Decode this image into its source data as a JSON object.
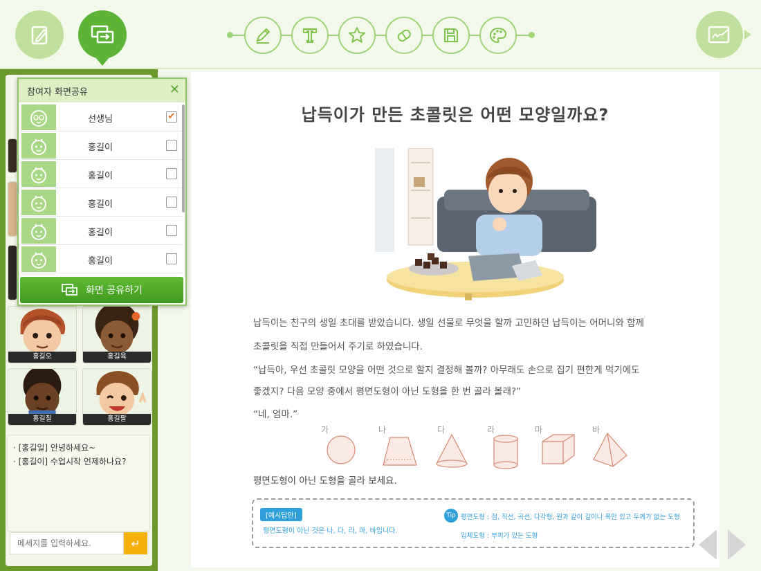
{
  "toolbar": {
    "modes": [
      {
        "icon": "edit-document-icon"
      },
      {
        "icon": "screen-share-icon",
        "active": true
      }
    ],
    "tools": [
      "pencil-icon",
      "text-icon",
      "star-icon",
      "eraser-icon",
      "save-icon",
      "palette-icon"
    ],
    "note_icon": "signature-board-icon"
  },
  "participants_popup": {
    "title": "참여자 화면공유",
    "participants": [
      {
        "name": "선생님",
        "role": "teacher",
        "checked": true,
        "check_mark": "✔"
      },
      {
        "name": "홍길이",
        "role": "student",
        "checked": false
      },
      {
        "name": "홍길이",
        "role": "student",
        "checked": false
      },
      {
        "name": "홍길이",
        "role": "student",
        "checked": false
      },
      {
        "name": "홍길이",
        "role": "student",
        "checked": false
      },
      {
        "name": "홍길이",
        "role": "student",
        "checked": false
      }
    ],
    "share_button": "화면 공유하기"
  },
  "students": [
    {
      "name": "홍길오"
    },
    {
      "name": "홍길육"
    },
    {
      "name": "홍길칠"
    },
    {
      "name": "홍길팔"
    }
  ],
  "chat": {
    "messages": [
      "· [홍길일] 안녕하세요~",
      "· [홍길이] 수업시작 언제하나요?"
    ],
    "input_placeholder": "메세지를 입력하세요.",
    "send_icon": "↵"
  },
  "document": {
    "title": "납득이가 만든 초콜릿은 어떤 모양일까요?",
    "paragraphs": [
      "납득이는 친구의 생일 초대를 받았습니다. 생일 선물로 무엇을 할까 고민하던 납득이는 어머니와 함께",
      "초콜릿을 직접 만들어서 주기로 하였습니다.",
      "“납득아, 우선 초콜릿 모양을 어떤 것으로 할지 결정해 볼까? 아무래도 손으로 집기 편한게 먹기에도",
      "좋겠지? 다음 모양 중에서 평면도형이 아닌 도형을 한 번 골라 볼래?”",
      "“네, 엄마.”"
    ],
    "shape_labels": [
      "가",
      "나",
      "다",
      "라",
      "마",
      "바"
    ],
    "question": "평면도형이 아닌 도형을 골라 보세요.",
    "answer_badge": "[예시답안]",
    "answer": "평면도형이 아닌 것은 나, 다, 라, 마, 바입니다.",
    "tip_badge": "Tip",
    "tips": [
      "평면도형 : 점, 직선, 곡선, 다각형, 원과 같이 길이나 폭만 있고 두께가 없는 도형",
      "입체도형 : 부피가 있는 도형"
    ]
  },
  "colors": {
    "accent_green": "#5db336",
    "panel_green": "#6a9a2c",
    "answer_blue": "#2e9fdb",
    "send_orange": "#f6b10c"
  }
}
